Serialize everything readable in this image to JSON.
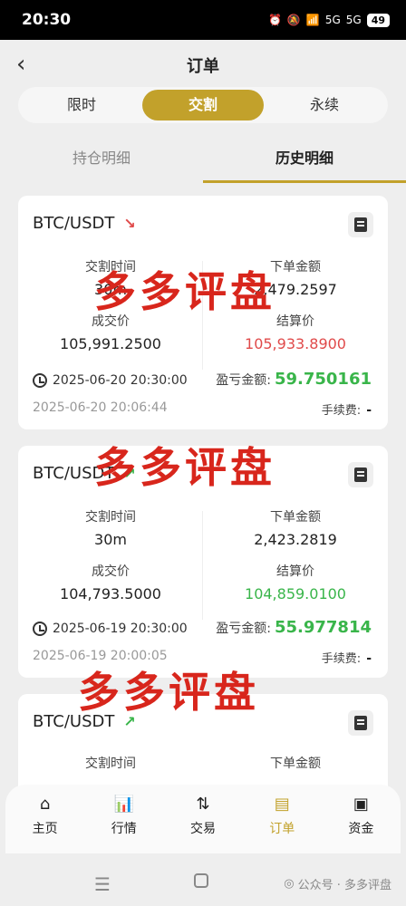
{
  "status": {
    "time": "20:30",
    "battery": "49",
    "net1": "5G",
    "net2": "5G"
  },
  "header": {
    "title": "订单"
  },
  "segments": [
    "限时",
    "交割",
    "永续"
  ],
  "subtabs": [
    "持仓明细",
    "历史明细"
  ],
  "cards": [
    {
      "pair": "BTC/USDT",
      "trend": "down",
      "labels": {
        "delivery": "交割时间",
        "amount": "下单金额",
        "deal": "成交价",
        "settle": "结算价",
        "pnl": "盈亏金额:",
        "fee": "手续费:"
      },
      "delivery": "30m",
      "amount": "2,479.2597",
      "deal": "105,991.2500",
      "settle": "105,933.8900",
      "close_time": "2025-06-20 20:30:00",
      "open_time": "2025-06-20 20:06:44",
      "pnl": "59.750161",
      "fee": "-"
    },
    {
      "pair": "BTC/USDT",
      "trend": "up",
      "labels": {
        "delivery": "交割时间",
        "amount": "下单金额",
        "deal": "成交价",
        "settle": "结算价",
        "pnl": "盈亏金额:",
        "fee": "手续费:"
      },
      "delivery": "30m",
      "amount": "2,423.2819",
      "deal": "104,793.5000",
      "settle": "104,859.0100",
      "close_time": "2025-06-19 20:30:00",
      "open_time": "2025-06-19 20:00:05",
      "pnl": "55.977814",
      "fee": "-"
    },
    {
      "pair": "BTC/USDT",
      "trend": "up",
      "labels": {
        "delivery": "交割时间",
        "amount": "下单金额"
      }
    }
  ],
  "watermark": "多多评盘",
  "nav": [
    {
      "label": "主页",
      "icon": "home-icon"
    },
    {
      "label": "行情",
      "icon": "market-chart-icon"
    },
    {
      "label": "交易",
      "icon": "swap-arrows-icon"
    },
    {
      "label": "订单",
      "icon": "order-document-icon"
    },
    {
      "label": "资金",
      "icon": "wallet-icon"
    }
  ],
  "system": {
    "footer_watermark": "公众号 · 多多评盘"
  },
  "colors": {
    "accent": "#c2a12b",
    "up": "#39b54a",
    "down": "#e04a4a",
    "watermark": "#d8261c"
  }
}
